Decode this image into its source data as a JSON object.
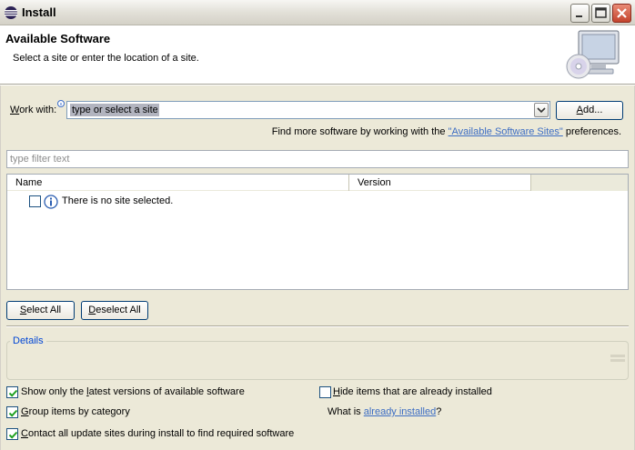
{
  "window": {
    "title": "Install"
  },
  "header": {
    "title": "Available Software",
    "description": "Select a site or enter the location of a site."
  },
  "work_with": {
    "label_prefix": "W",
    "label_rest": "ork with:",
    "value": "type or select a site",
    "add_label_prefix": "A",
    "add_label_rest": "dd..."
  },
  "find_more": {
    "prefix": "Find more software by working with the ",
    "link": "\"Available Software Sites\"",
    "suffix": " preferences."
  },
  "filter": {
    "placeholder": "type filter text"
  },
  "table": {
    "columns": [
      "Name",
      "Version",
      ""
    ],
    "rows": [
      {
        "checked": false,
        "icon": "info-icon",
        "text": "There is no site selected."
      }
    ]
  },
  "buttons": {
    "select_all_prefix": "S",
    "select_all_rest": "elect All",
    "deselect_all_prefix": "D",
    "deselect_all_rest": "eselect All"
  },
  "details": {
    "label": "Details"
  },
  "options": {
    "latest_a": "Show only the ",
    "latest_u": "l",
    "latest_b": "atest versions of available software",
    "group_a": "",
    "group_u": "G",
    "group_b": "roup items by category",
    "contact_a": "",
    "contact_u": "C",
    "contact_b": "ontact all update sites during install to find required software",
    "hide_a": "",
    "hide_u": "H",
    "hide_b": "ide items that are already installed",
    "whatis_prefix": "What is ",
    "whatis_link": "already installed",
    "whatis_suffix": "?"
  },
  "checkbox_states": {
    "latest": true,
    "group": true,
    "contact": true,
    "hide": false
  },
  "colors": {
    "link": "#3c6dc3",
    "dialog_bg": "#ece9d8",
    "selection_bg": "#b2b4bf"
  }
}
